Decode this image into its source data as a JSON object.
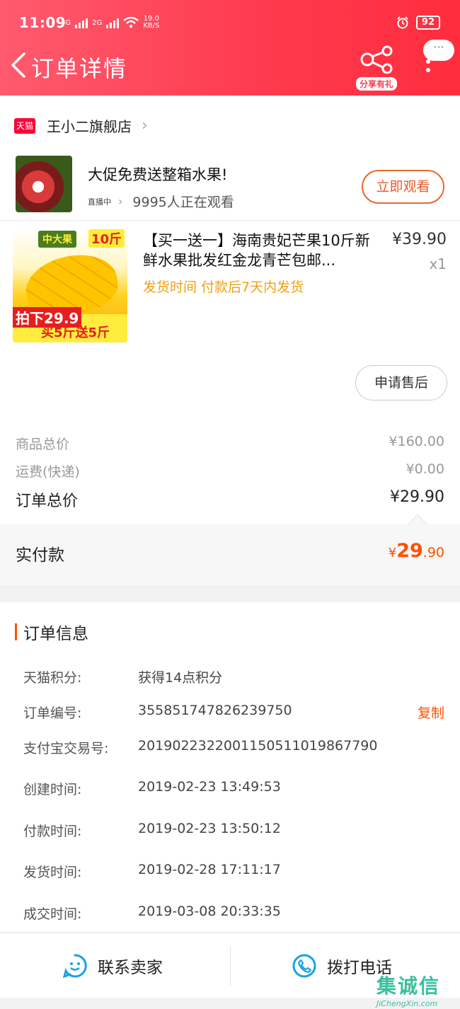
{
  "status_bar": {
    "time": "11:09",
    "net_speed_value": "19.0",
    "net_speed_unit": "KB/S",
    "battery": "92",
    "network_labels": [
      "4G",
      "2G"
    ]
  },
  "header": {
    "title": "订单详情",
    "share_label": "分享有礼",
    "chat_bubble": "···"
  },
  "store": {
    "badge": "天猫",
    "name": "王小二旗舰店"
  },
  "live": {
    "title": "大促免费送整箱水果!",
    "tag": "直播中",
    "viewers": "9995人正在观看",
    "watch_button": "立即观看"
  },
  "product": {
    "title": "【买一送一】海南贵妃芒果10斤新鲜水果批发红金龙青芒包邮...",
    "price": "¥39.90",
    "quantity": "x1",
    "ship_time": "发货时间 付款后7天内发货",
    "image_text": {
      "badge1": "中大果",
      "badge2": "10斤",
      "price_tag": "拍下29.9",
      "promo": "买5斤送5斤"
    },
    "aftersale_button": "申请售后"
  },
  "summary": {
    "goods_total_label": "商品总价",
    "goods_total_value": "¥160.00",
    "shipping_label": "运费(快递)",
    "shipping_value": "¥0.00",
    "order_total_label": "订单总价",
    "order_total_value": "¥29.90",
    "paid_label": "实付款",
    "paid_currency": "¥",
    "paid_integer": "29",
    "paid_decimal": ".90"
  },
  "order_info": {
    "heading": "订单信息",
    "rows": [
      {
        "label": "天猫积分:",
        "value": "获得14点积分"
      },
      {
        "label": "订单编号:",
        "value": "355851747826239750"
      },
      {
        "label": "支付宝交易号:",
        "value": "2019022322001150511019867790"
      },
      {
        "label": "创建时间:",
        "value": "2019-02-23 13:49:53"
      },
      {
        "label": "付款时间:",
        "value": "2019-02-23 13:50:12"
      },
      {
        "label": "发货时间:",
        "value": "2019-02-28 17:11:17"
      },
      {
        "label": "成交时间:",
        "value": "2019-03-08 20:33:35"
      }
    ],
    "copy_label": "复制"
  },
  "bottom_bar": {
    "contact_seller": "联系卖家",
    "call_phone": "拨打电话"
  },
  "watermark": {
    "text": "集诚信",
    "sub": "JiChengXin.com"
  },
  "colors": {
    "header_red": "#ff3b4f",
    "accent_orange": "#ff5000",
    "ship_time_yellow": "#f0a010",
    "icon_blue": "#1aa0e8"
  }
}
